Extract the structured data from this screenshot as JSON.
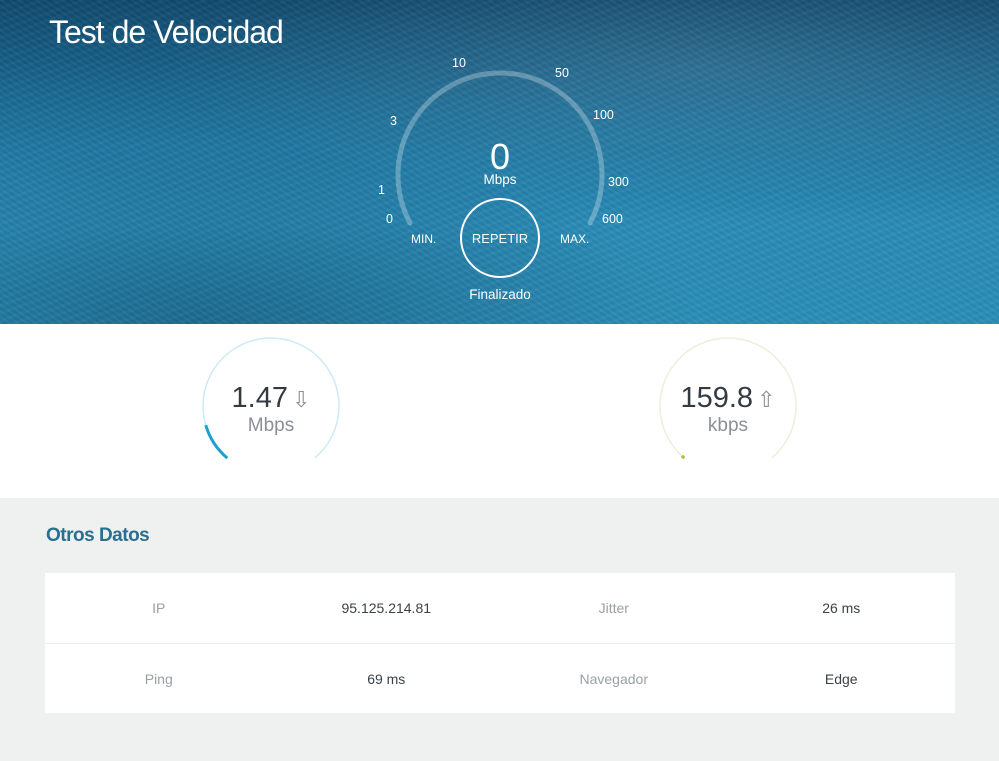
{
  "header": {
    "title": "Test de Velocidad"
  },
  "gauge": {
    "scale_labels": [
      "0",
      "1",
      "3",
      "10",
      "50",
      "100",
      "300",
      "600"
    ],
    "current_value": "0",
    "unit": "Mbps",
    "min_label": "MIN.",
    "max_label": "MAX.",
    "button_label": "REPETIR",
    "status": "Finalizado"
  },
  "results": {
    "download": {
      "value": "1.47",
      "unit": "Mbps",
      "arrow": "⇩",
      "progress_fraction": 0.12,
      "color": "#1e9fd0"
    },
    "upload": {
      "value": "159.8",
      "unit": "kbps",
      "arrow": "⇧",
      "progress_fraction": 0.01,
      "color": "#a3c23a"
    }
  },
  "other_data": {
    "title": "Otros Datos",
    "rows": [
      [
        {
          "label": "IP",
          "value": "95.125.214.81"
        },
        {
          "label": "Jitter",
          "value": "26 ms"
        }
      ],
      [
        {
          "label": "Ping",
          "value": "69 ms"
        },
        {
          "label": "Navegador",
          "value": "Edge"
        }
      ]
    ]
  },
  "colors": {
    "accent": "#1e9fd0",
    "title_blue": "#2a6f8f"
  }
}
